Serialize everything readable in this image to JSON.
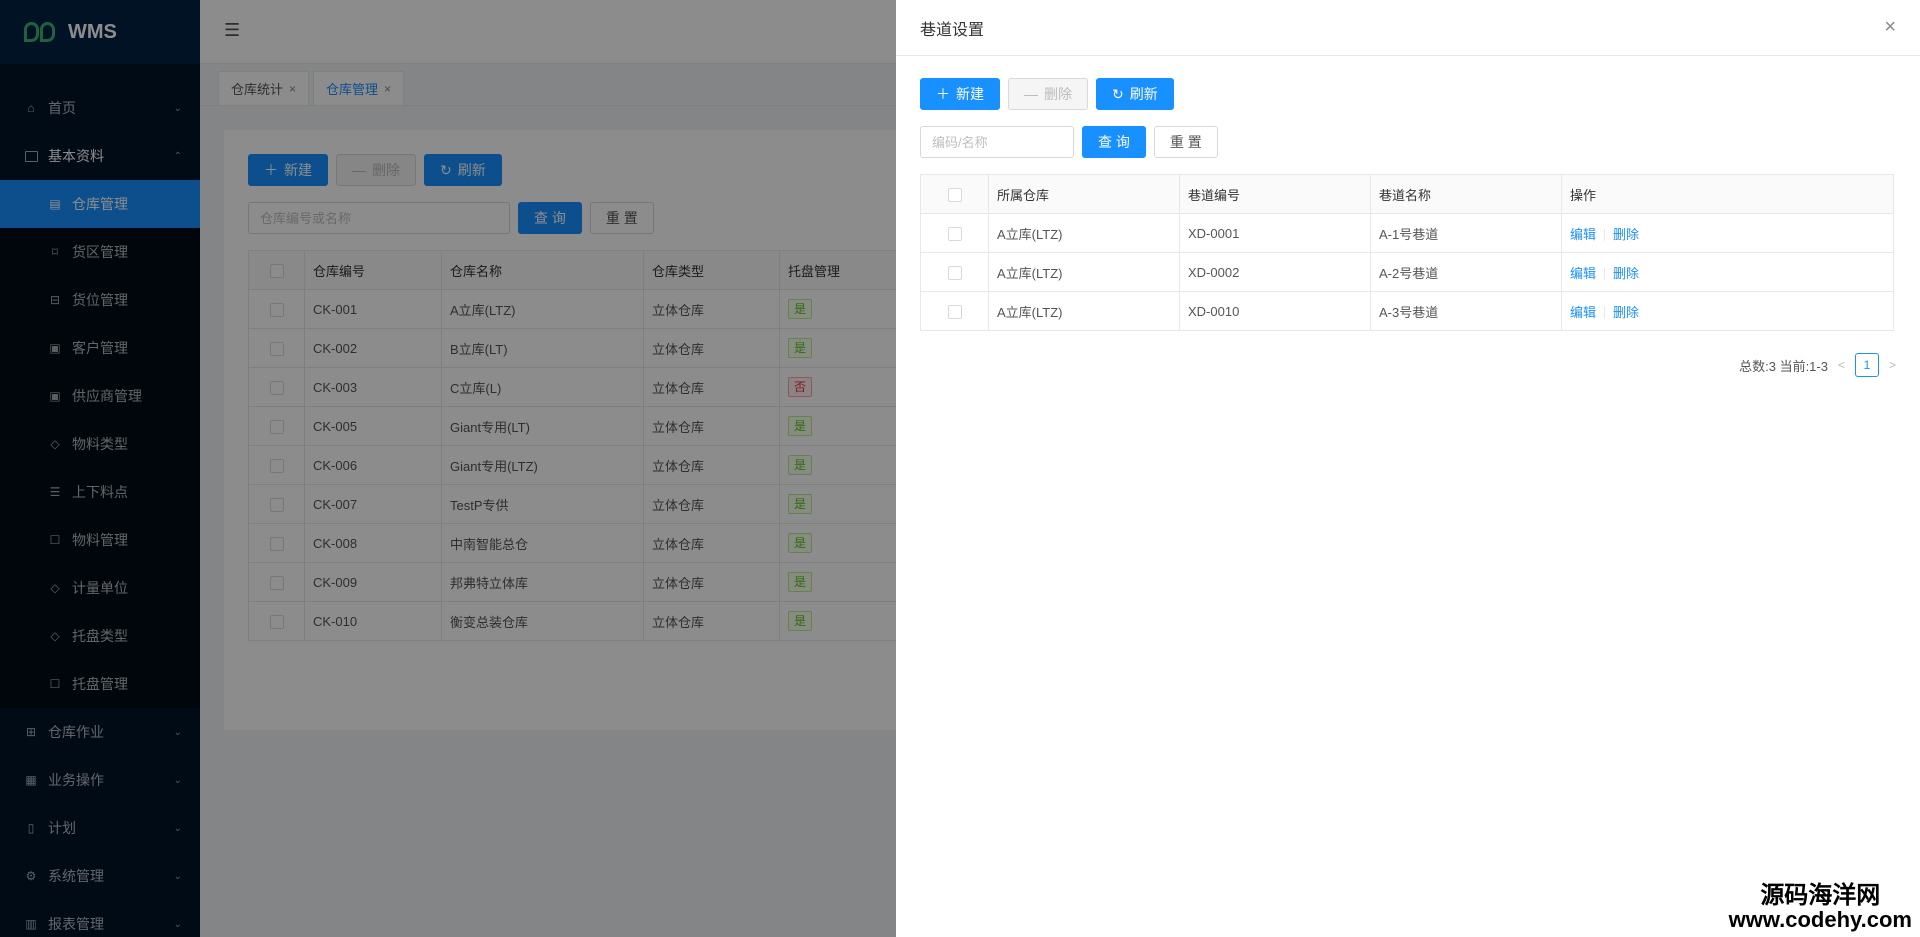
{
  "app": {
    "logo_text": "WMS"
  },
  "sidebar": {
    "items": [
      {
        "label": "首页",
        "icon": "home-icon",
        "chevron": "⌄"
      },
      {
        "label": "基本资料",
        "icon": "book-icon",
        "chevron": "⌃"
      }
    ],
    "subitems": [
      {
        "label": "仓库管理",
        "icon": "warehouse-icon"
      },
      {
        "label": "货区管理",
        "icon": "area-icon"
      },
      {
        "label": "货位管理",
        "icon": "slot-icon"
      },
      {
        "label": "客户管理",
        "icon": "customer-icon"
      },
      {
        "label": "供应商管理",
        "icon": "supplier-icon"
      },
      {
        "label": "物料类型",
        "icon": "tag-icon"
      },
      {
        "label": "上下料点",
        "icon": "list-icon"
      },
      {
        "label": "物料管理",
        "icon": "box-icon"
      },
      {
        "label": "计量单位",
        "icon": "tag-icon"
      },
      {
        "label": "托盘类型",
        "icon": "tag-icon"
      },
      {
        "label": "托盘管理",
        "icon": "box-icon"
      }
    ],
    "bottom_items": [
      {
        "label": "仓库作业",
        "icon": "grid-icon",
        "chevron": "⌄"
      },
      {
        "label": "业务操作",
        "icon": "doc-icon",
        "chevron": "⌄"
      },
      {
        "label": "计划",
        "icon": "file-icon",
        "chevron": "⌄"
      },
      {
        "label": "系统管理",
        "icon": "gear-icon",
        "chevron": "⌄"
      },
      {
        "label": "报表管理",
        "icon": "chart-icon",
        "chevron": "⌄"
      }
    ]
  },
  "tabs": [
    {
      "label": "仓库统计",
      "close": "×"
    },
    {
      "label": "仓库管理",
      "close": "×"
    }
  ],
  "main": {
    "new_label": "新建",
    "delete_label": "删除",
    "refresh_label": "刷新",
    "search_placeholder": "仓库编号或名称",
    "query_label": "查 询",
    "reset_label": "重 置",
    "columns": [
      "仓库编号",
      "仓库名称",
      "仓库类型",
      "托盘管理"
    ],
    "rows": [
      {
        "code": "CK-001",
        "name": "A立库(LTZ)",
        "type": "立体仓库",
        "pallet": "是"
      },
      {
        "code": "CK-002",
        "name": "B立库(LT)",
        "type": "立体仓库",
        "pallet": "是"
      },
      {
        "code": "CK-003",
        "name": "C立库(L)",
        "type": "立体仓库",
        "pallet": "否"
      },
      {
        "code": "CK-005",
        "name": "Giant专用(LT)",
        "type": "立体仓库",
        "pallet": "是"
      },
      {
        "code": "CK-006",
        "name": "Giant专用(LTZ)",
        "type": "立体仓库",
        "pallet": "是"
      },
      {
        "code": "CK-007",
        "name": "TestP专供",
        "type": "立体仓库",
        "pallet": "是"
      },
      {
        "code": "CK-008",
        "name": "中南智能总仓",
        "type": "立体仓库",
        "pallet": "是"
      },
      {
        "code": "CK-009",
        "name": "邦弗特立体库",
        "type": "立体仓库",
        "pallet": "是"
      },
      {
        "code": "CK-010",
        "name": "衡变总装仓库",
        "type": "立体仓库",
        "pallet": "是"
      }
    ]
  },
  "drawer": {
    "title": "巷道设置",
    "close": "×",
    "new_label": "新建",
    "delete_label": "删除",
    "refresh_label": "刷新",
    "search_placeholder": "编码/名称",
    "query_label": "查 询",
    "reset_label": "重 置",
    "columns": [
      "所属仓库",
      "巷道编号",
      "巷道名称",
      "操作"
    ],
    "rows": [
      {
        "warehouse": "A立库(LTZ)",
        "code": "XD-0001",
        "name": "A-1号巷道",
        "edit": "编辑",
        "delete": "删除"
      },
      {
        "warehouse": "A立库(LTZ)",
        "code": "XD-0002",
        "name": "A-2号巷道",
        "edit": "编辑",
        "delete": "删除"
      },
      {
        "warehouse": "A立库(LTZ)",
        "code": "XD-0010",
        "name": "A-3号巷道",
        "edit": "编辑",
        "delete": "删除"
      }
    ],
    "pagination": {
      "summary": "总数:3 当前:1-3",
      "prev": "<",
      "current": "1",
      "next": ">"
    }
  },
  "watermark": {
    "cn": "源码海洋网",
    "url": "www.codehy.com"
  },
  "colors": {
    "primary": "#1890ff",
    "sidebar": "#001529",
    "success": "#52c41a",
    "danger": "#f5222d"
  }
}
